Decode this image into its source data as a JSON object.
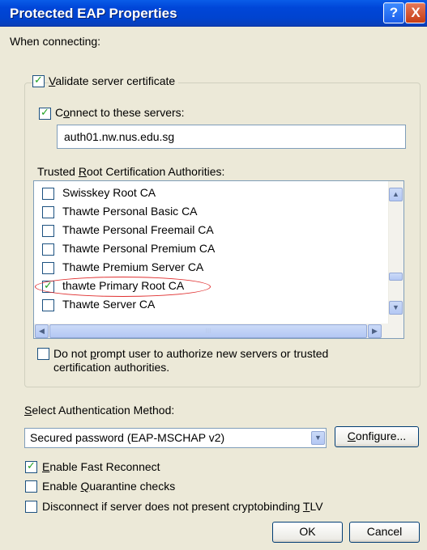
{
  "dialog": {
    "title": "Protected EAP Properties",
    "help_glyph": "?",
    "close_glyph": "X"
  },
  "when_connecting": {
    "label": "When connecting:"
  },
  "validate_cert": {
    "label_pre": "",
    "label_underlined": "V",
    "label_post": "alidate server certificate",
    "checked": true
  },
  "connect_servers": {
    "label_pre": "C",
    "label_underlined": "o",
    "label_post": "nnect to these servers:",
    "checked": true,
    "value": "auth01.nw.nus.edu.sg"
  },
  "trusted_ca": {
    "label_pre": "Trusted ",
    "label_underlined": "R",
    "label_post": "oot Certification Authorities:",
    "items": [
      {
        "label": "Swisskey Root CA",
        "checked": false
      },
      {
        "label": "Thawte Personal Basic CA",
        "checked": false
      },
      {
        "label": "Thawte Personal Freemail CA",
        "checked": false
      },
      {
        "label": "Thawte Personal Premium CA",
        "checked": false
      },
      {
        "label": "Thawte Premium Server CA",
        "checked": false
      },
      {
        "label": "thawte Primary Root CA",
        "checked": true
      },
      {
        "label": "Thawte Server CA",
        "checked": false
      }
    ],
    "scroll_up_glyph": "▲",
    "scroll_down_glyph": "▼",
    "scroll_left_glyph": "◀",
    "scroll_right_glyph": "▶",
    "scroll_thumb_grip": "III"
  },
  "no_prompt": {
    "line1_pre": "Do not ",
    "line1_underlined": "p",
    "line1_post": "rompt user to authorize new servers or trusted",
    "line2": "certification authorities.",
    "checked": false
  },
  "auth_method": {
    "label_pre": "",
    "label_underlined": "S",
    "label_post": "elect Authentication Method:",
    "selected": "Secured password (EAP-MSCHAP v2)",
    "dropdown_glyph": "▼",
    "configure_pre": "",
    "configure_underlined": "C",
    "configure_post": "onfigure..."
  },
  "options": {
    "fast_reconnect": {
      "label_pre": "",
      "label_underlined": "E",
      "label_post": "nable Fast Reconnect",
      "checked": true
    },
    "quarantine": {
      "label_pre": "Enable ",
      "label_underlined": "Q",
      "label_post": "uarantine checks",
      "checked": false
    },
    "cryptobinding": {
      "label_pre": "Disconnect if server does not present cryptobinding ",
      "label_underlined": "T",
      "label_post": "LV",
      "checked": false
    }
  },
  "buttons": {
    "ok": "OK",
    "cancel": "Cancel"
  },
  "check_glyph": "✓",
  "colors": {
    "title_bar": "#0046d8",
    "dialog_bg": "#ece9d8",
    "check": "#21a121",
    "highlight_oval": "#e03030",
    "scroll_button": "#b4c8f4"
  }
}
